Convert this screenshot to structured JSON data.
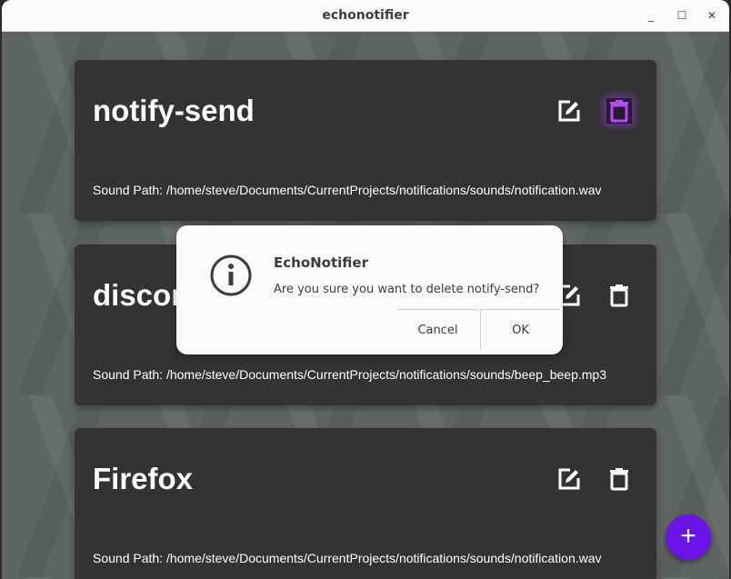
{
  "window": {
    "title": "echonotifier",
    "controls": [
      "minimize",
      "maximize",
      "close"
    ]
  },
  "notifiers": [
    {
      "name": "notify-send",
      "sound_path_label": "Sound Path: /home/steve/Documents/CurrentProjects/notifications/sounds/notification.wav",
      "delete_highlighted": true
    },
    {
      "name": "discord",
      "sound_path_label": "Sound Path: /home/steve/Documents/CurrentProjects/notifications/sounds/beep_beep.mp3",
      "delete_highlighted": false
    },
    {
      "name": "Firefox",
      "sound_path_label": "Sound Path: /home/steve/Documents/CurrentProjects/notifications/sounds/notification.wav",
      "delete_highlighted": false
    }
  ],
  "dialog": {
    "title": "EchoNotifier",
    "message": "Are you sure you want to delete notify-send?",
    "cancel_label": "Cancel",
    "ok_label": "OK",
    "icon": "info-icon"
  },
  "fab": {
    "label": "+",
    "icon": "plus-icon"
  },
  "colors": {
    "accent": "#6a14e8",
    "highlight": "#b44cf0",
    "card": "#333333"
  }
}
